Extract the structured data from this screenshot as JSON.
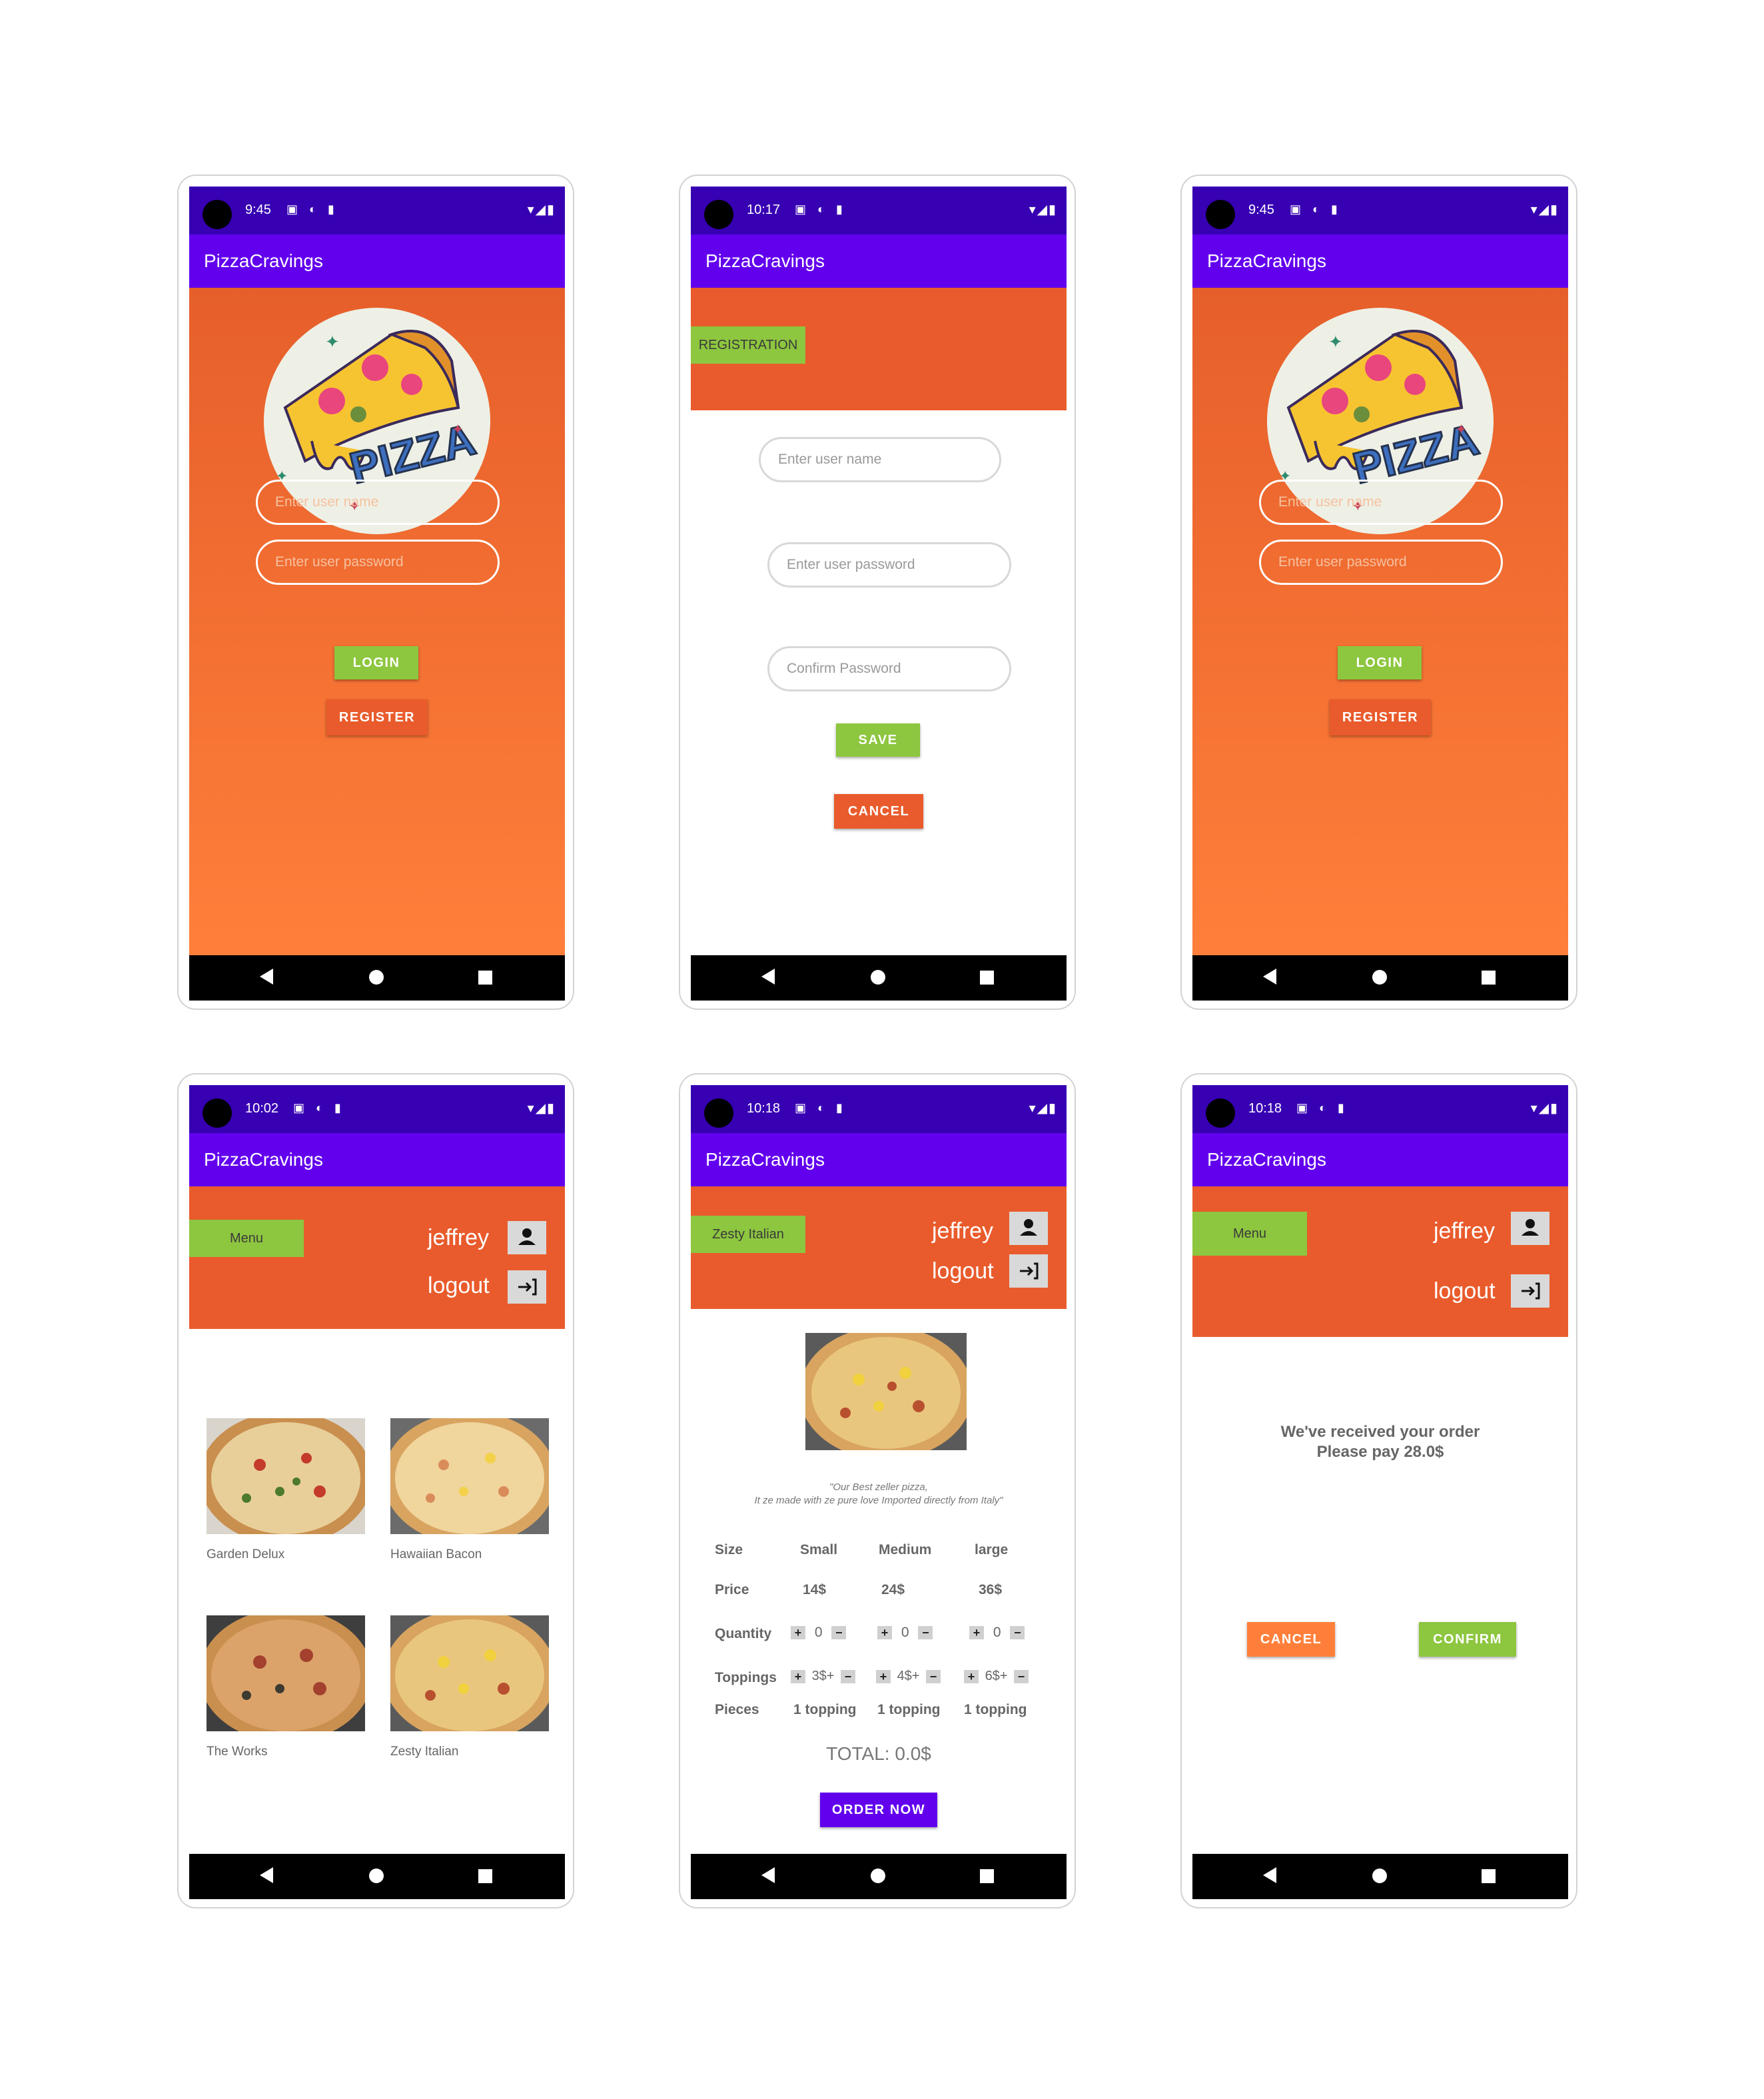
{
  "app": {
    "title": "PizzaCravings"
  },
  "colors": {
    "status_bar": "#3700b3",
    "app_bar": "#6200ee",
    "orange": "#e95b2c",
    "green": "#8dc63f",
    "purple": "#6200ee"
  },
  "icons": {
    "battery": "battery-icon",
    "wifi": "wifi-icon",
    "signal": "signal-icon",
    "person": "person-icon",
    "logout": "logout-icon"
  },
  "screens": {
    "login1": {
      "time": "9:45",
      "logo_text": "PIZZA",
      "username_placeholder": "Enter user name",
      "password_placeholder": "Enter user password",
      "login_label": "LOGIN",
      "register_label": "REGISTER"
    },
    "register": {
      "time": "10:17",
      "tag": "REGISTRATION",
      "username_placeholder": "Enter user name",
      "password_placeholder": "Enter user password",
      "confirm_placeholder": "Confirm Password",
      "save_label": "SAVE",
      "cancel_label": "CANCEL"
    },
    "login2": {
      "time": "9:45",
      "logo_text": "PIZZA",
      "username_placeholder": "Enter user name",
      "password_placeholder": "Enter user password",
      "login_label": "LOGIN",
      "register_label": "REGISTER"
    },
    "menu": {
      "time": "10:02",
      "menu_tag": "Menu",
      "username": "jeffrey",
      "logout": "logout",
      "items": [
        {
          "name": "Garden Delux"
        },
        {
          "name": "Hawaiian Bacon"
        },
        {
          "name": "The Works"
        },
        {
          "name": "Zesty Italian"
        }
      ]
    },
    "detail": {
      "time": "10:18",
      "tag": "Zesty Italian",
      "username": "jeffrey",
      "logout": "logout",
      "description_line1": "\"Our Best zeller pizza,",
      "description_line2": "It ze made with ze pure love Imported directly from Italy\"",
      "headers": [
        "Size",
        "Small",
        "Medium",
        "large"
      ],
      "price_label": "Price",
      "prices": [
        "14$",
        "24$",
        "36$"
      ],
      "quantity_label": "Quantity",
      "quantities": [
        "0",
        "0",
        "0"
      ],
      "toppings_label": "Toppings",
      "toppings": [
        "3$+",
        "4$+",
        "6$+"
      ],
      "pieces_label": "Pieces",
      "pieces": [
        "1 topping",
        "1 topping",
        "1 topping"
      ],
      "plus": "+",
      "minus": "−",
      "total": "TOTAL:  0.0$",
      "order_label": "ORDER NOW"
    },
    "confirm": {
      "time": "10:18",
      "menu_tag": "Menu",
      "username": "jeffrey",
      "logout": "logout",
      "message_line1": "We've received your order",
      "message_line2": "Please pay 28.0$",
      "cancel_label": "CANCEL",
      "confirm_label": "CONFIRM"
    }
  }
}
